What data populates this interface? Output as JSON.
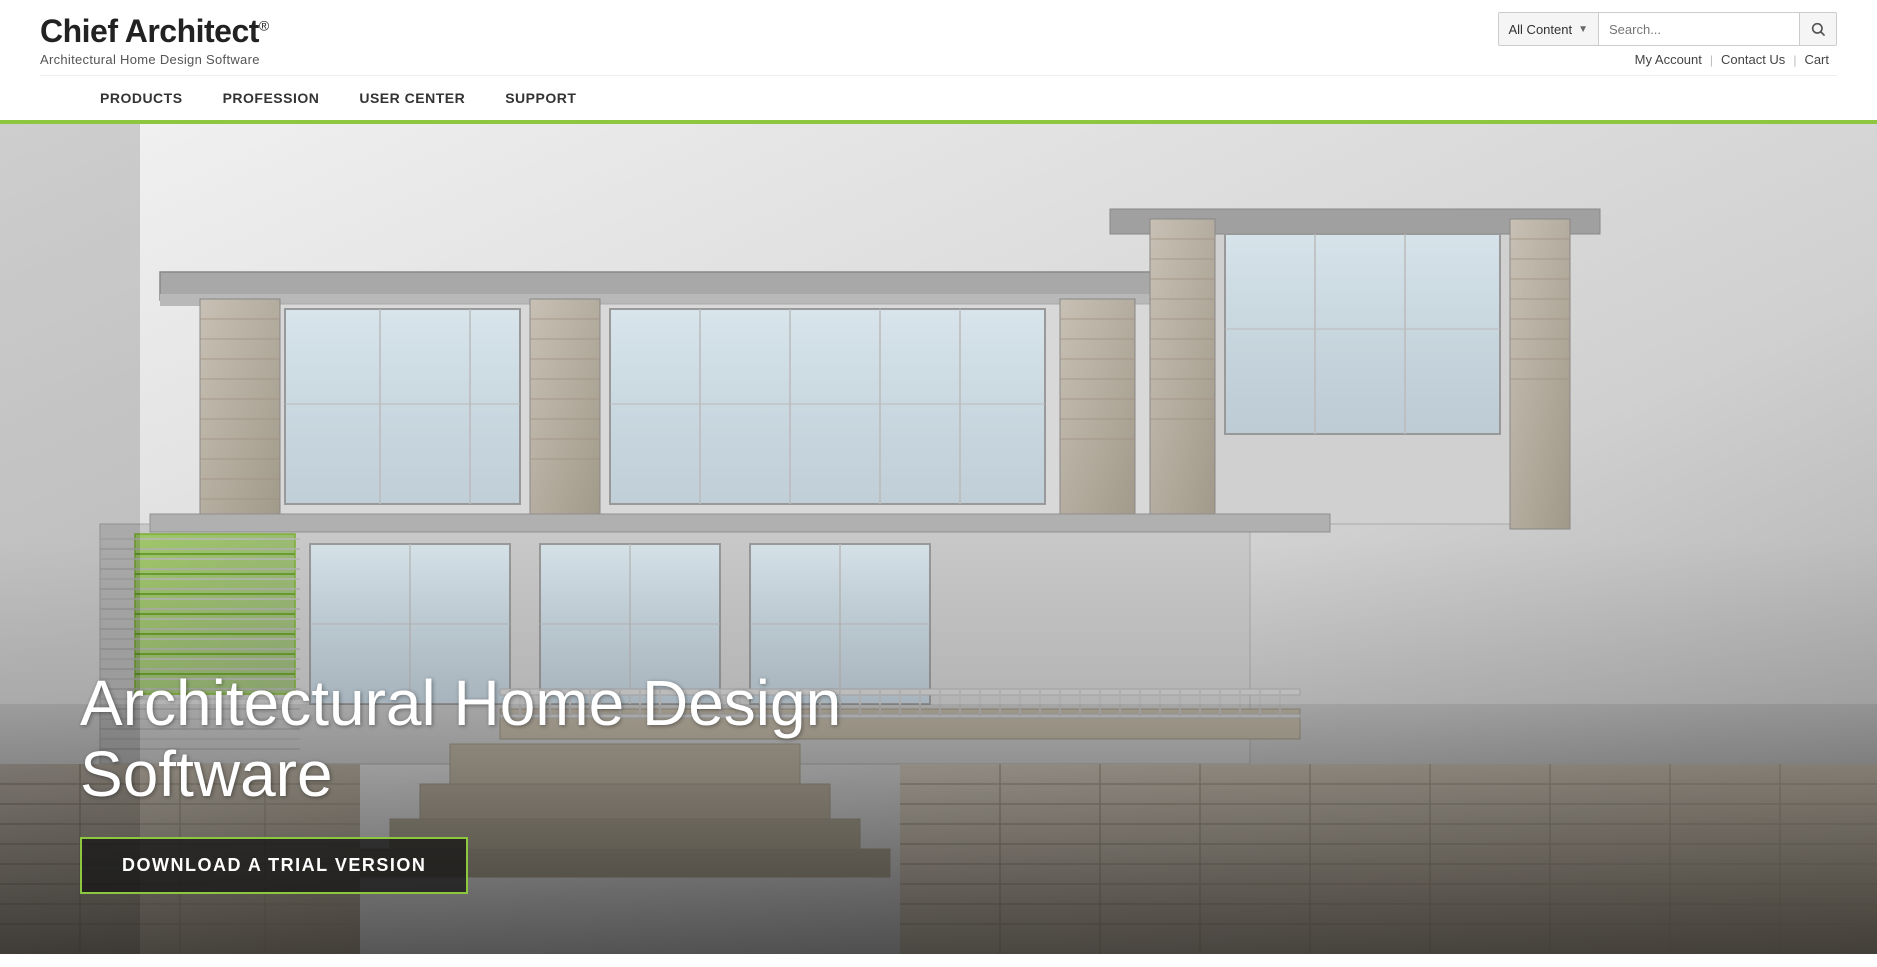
{
  "brand": {
    "name_prefix": "Chief Architect",
    "name_suffix": "®",
    "tagline": "Architectural Home Design Software"
  },
  "search": {
    "filter_label": "All Content",
    "placeholder": "Search...",
    "button_icon": "🔍"
  },
  "header_links": {
    "my_account": "My Account",
    "contact_us": "Contact Us",
    "cart": "Cart"
  },
  "nav": {
    "items": [
      {
        "label": "PRODUCTS",
        "id": "products"
      },
      {
        "label": "PROFESSION",
        "id": "profession"
      },
      {
        "label": "USER CENTER",
        "id": "user-center"
      },
      {
        "label": "SUPPORT",
        "id": "support"
      }
    ]
  },
  "hero": {
    "heading": "Architectural Home Design Software",
    "cta_label": "DOWNLOAD A TRIAL VERSION"
  }
}
